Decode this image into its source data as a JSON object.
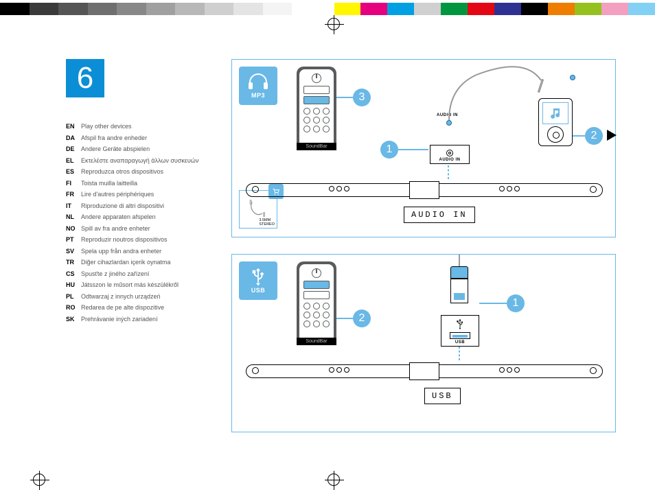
{
  "step_number": "6",
  "languages": [
    {
      "code": "EN",
      "text": "Play other devices"
    },
    {
      "code": "DA",
      "text": "Afspil fra andre enheder"
    },
    {
      "code": "DE",
      "text": "Andere Geräte abspielen"
    },
    {
      "code": "EL",
      "text": "Εκτελέστε αναπαραγωγή άλλων συσκευών"
    },
    {
      "code": "ES",
      "text": "Reproduzca otros dispositivos"
    },
    {
      "code": "FI",
      "text": "Toista muilla laitteilla"
    },
    {
      "code": "FR",
      "text": "Lire d'autres périphériques"
    },
    {
      "code": "IT",
      "text": "Riproduzione di altri dispositivi"
    },
    {
      "code": "NL",
      "text": "Andere apparaten afspelen"
    },
    {
      "code": "NO",
      "text": "Spill av fra andre enheter"
    },
    {
      "code": "PT",
      "text": "Reproduzir noutros dispositivos"
    },
    {
      "code": "SV",
      "text": "Spela upp från andra enheter"
    },
    {
      "code": "TR",
      "text": "Diğer cihazlardan içerik oynatma"
    },
    {
      "code": "CS",
      "text": "Spusťte z jiného zařízení"
    },
    {
      "code": "HU",
      "text": "Játsszon le műsort más készülékről"
    },
    {
      "code": "PL",
      "text": "Odtwarzaj z innych urządzeń"
    },
    {
      "code": "RO",
      "text": "Redarea de pe alte dispozitive"
    },
    {
      "code": "SK",
      "text": "Prehrávanie iných zariadení"
    }
  ],
  "panel_mp3": {
    "badge_label": "MP3",
    "cable_label_line1": "3.5MM",
    "cable_label_line2": "STEREO",
    "remote_label": "SoundBar",
    "port_label": "AUDIO IN",
    "jack_label": "AUDIO IN",
    "display_text": "AUDIO IN",
    "step_remote": "3",
    "step_port": "1",
    "step_player": "2"
  },
  "panel_usb": {
    "badge_label": "USB",
    "remote_label": "SoundBar",
    "port_label": "USB",
    "display_text": "USB",
    "step_plug": "1",
    "step_remote": "2"
  },
  "colorbar_left": [
    "#000",
    "#3a3a3a",
    "#555",
    "#6f6f6f",
    "#888",
    "#a0a0a0",
    "#b8b8b8",
    "#cfcfcf",
    "#e4e4e4",
    "#f4f4f4",
    "#fff"
  ],
  "colorbar_right": [
    "#fff600",
    "#e6007e",
    "#00a0e3",
    "#d0d0d0",
    "#009640",
    "#e30613",
    "#2e3192",
    "#000",
    "#ef7d00",
    "#95c11f",
    "#f39fbf",
    "#83d0f5"
  ]
}
